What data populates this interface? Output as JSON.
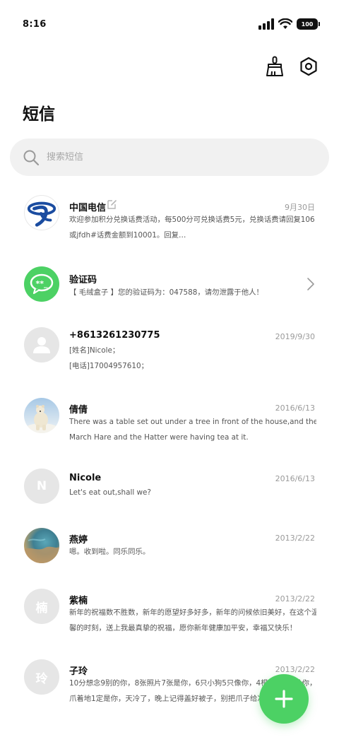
{
  "status_bar": {
    "time": "8:16",
    "battery": "100"
  },
  "toolbar": {
    "clean_icon": "broom-icon",
    "settings_icon": "hexagon-settings-icon"
  },
  "page": {
    "title": "短信"
  },
  "search": {
    "placeholder": "搜索短信",
    "value": ""
  },
  "conversations": [
    {
      "name": "中国电信",
      "date": "9月30日",
      "line1": "欢迎参加积分兑换话费活动，每500分可兑换话费5元，兑换话费请回复106",
      "line2": "或jfdh#话费金额到10001。回复…",
      "avatar": "china-telecom-logo"
    },
    {
      "name": "验证码",
      "date": "",
      "line1": "【 毛绒盒子 】您的验证码为：047588，请勿泄露于他人！",
      "line2": "",
      "avatar": "message-bubble-icon"
    },
    {
      "name": "+8613261230775",
      "date": "2019/9/30",
      "line1": "[姓名]Nicole；",
      "line2": "[电话]17004957610；",
      "avatar": "person-icon"
    },
    {
      "name": "倩倩",
      "date": "2016/6/13",
      "line1": "There was a table set out under a tree in front of the house,and the",
      "line2": "March Hare and the Hatter were having tea at it.",
      "avatar": "polar-bear-photo"
    },
    {
      "name": "Nicole",
      "date": "2016/6/13",
      "line1": "Let's eat out,shall we?",
      "line2": "",
      "avatar_letter": "N"
    },
    {
      "name": "燕婷",
      "date": "2013/2/22",
      "line1": "嗯。收到啦。同乐同乐。",
      "line2": "",
      "avatar": "ocean-photo"
    },
    {
      "name": "紫楠",
      "date": "2013/2/22",
      "line1": "新年的祝福数不胜数，新年的愿望好多好多，新年的问候依旧美好，在这个温",
      "line2": "馨的时刻，送上我最真挚的祝福，愿你新年健康加平安，幸福又快乐！",
      "avatar_letter": "楠"
    },
    {
      "name": "子玲",
      "date": "2013/2/22",
      "line1": "10分想念9别的你，8张照片7张是你，6只小狗5只像你，4根骨头3根给你，2",
      "line2": "爪着地1定是你，天冷了，晚上记得盖好被子，别把爪子给冻坏了",
      "avatar_letter": "玲"
    }
  ],
  "fab": {
    "icon": "plus-icon",
    "color": "#4cd164"
  },
  "colors": {
    "accent": "#4cd164",
    "telecom_blue": "#1a4ca0",
    "avatar_gray": "#e6e6e6"
  }
}
